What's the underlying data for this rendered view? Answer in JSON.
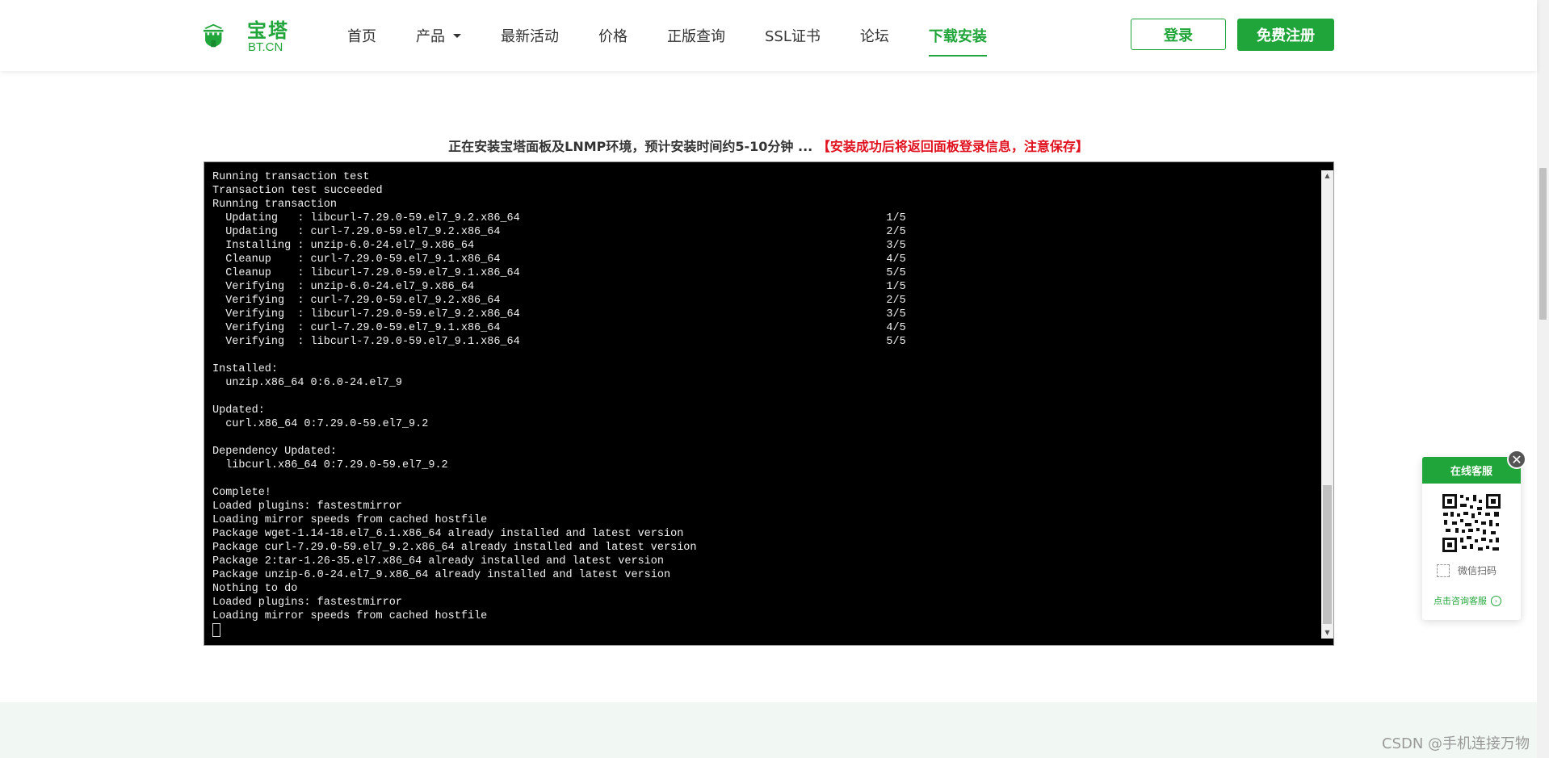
{
  "header": {
    "logo": {
      "cn": "宝塔",
      "en": "BT.CN"
    },
    "nav": [
      {
        "label": "首页",
        "name": "nav-home"
      },
      {
        "label": "产品",
        "name": "nav-products",
        "dropdown": true
      },
      {
        "label": "最新活动",
        "name": "nav-activities"
      },
      {
        "label": "价格",
        "name": "nav-price"
      },
      {
        "label": "正版查询",
        "name": "nav-license-check"
      },
      {
        "label": "SSL证书",
        "name": "nav-ssl"
      },
      {
        "label": "论坛",
        "name": "nav-forum"
      },
      {
        "label": "下载安装",
        "name": "nav-download",
        "active": true
      }
    ],
    "login_label": "登录",
    "register_label": "免费注册"
  },
  "notice": {
    "main": "正在安装宝塔面板及LNMP环境，预计安装时间约5-10分钟 ...",
    "warning": "【安装成功后将返回面板登录信息，注意保存】"
  },
  "terminal": {
    "lines": [
      "Running transaction test",
      "Transaction test succeeded",
      "Running transaction",
      "  Updating   : libcurl-7.29.0-59.el7_9.2.x86_64                                                        1/5",
      "  Updating   : curl-7.29.0-59.el7_9.2.x86_64                                                           2/5",
      "  Installing : unzip-6.0-24.el7_9.x86_64                                                               3/5",
      "  Cleanup    : curl-7.29.0-59.el7_9.1.x86_64                                                           4/5",
      "  Cleanup    : libcurl-7.29.0-59.el7_9.1.x86_64                                                        5/5",
      "  Verifying  : unzip-6.0-24.el7_9.x86_64                                                               1/5",
      "  Verifying  : curl-7.29.0-59.el7_9.2.x86_64                                                           2/5",
      "  Verifying  : libcurl-7.29.0-59.el7_9.2.x86_64                                                        3/5",
      "  Verifying  : curl-7.29.0-59.el7_9.1.x86_64                                                           4/5",
      "  Verifying  : libcurl-7.29.0-59.el7_9.1.x86_64                                                        5/5",
      "",
      "Installed:",
      "  unzip.x86_64 0:6.0-24.el7_9",
      "",
      "Updated:",
      "  curl.x86_64 0:7.29.0-59.el7_9.2",
      "",
      "Dependency Updated:",
      "  libcurl.x86_64 0:7.29.0-59.el7_9.2",
      "",
      "Complete!",
      "Loaded plugins: fastestmirror",
      "Loading mirror speeds from cached hostfile",
      "Package wget-1.14-18.el7_6.1.x86_64 already installed and latest version",
      "Package curl-7.29.0-59.el7_9.2.x86_64 already installed and latest version",
      "Package 2:tar-1.26-35.el7.x86_64 already installed and latest version",
      "Package unzip-6.0-24.el7_9.x86_64 already installed and latest version",
      "Nothing to do",
      "Loaded plugins: fastestmirror",
      "Loading mirror speeds from cached hostfile"
    ]
  },
  "service": {
    "title": "在线客服",
    "scan_label": "微信扫码",
    "consult_label": "点击咨询客服"
  },
  "watermark": "CSDN @手机连接万物",
  "colors": {
    "brand": "#20a53a",
    "warning": "#e0101e",
    "terminal_bg": "#000000"
  }
}
